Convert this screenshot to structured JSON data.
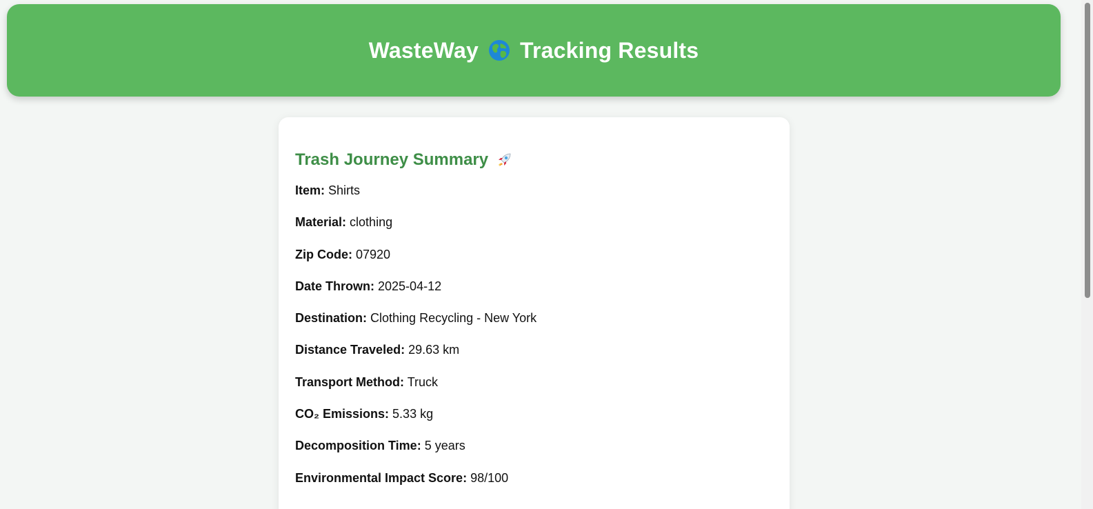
{
  "header": {
    "title_prefix": "WasteWay",
    "title_suffix": "Tracking Results",
    "icon": "globe-icon"
  },
  "summary": {
    "heading": "Trash Journey Summary",
    "heading_icon": "rocket-icon",
    "rows": [
      {
        "label": "Item:",
        "value": "Shirts"
      },
      {
        "label": "Material:",
        "value": "clothing"
      },
      {
        "label": "Zip Code:",
        "value": "07920"
      },
      {
        "label": "Date Thrown:",
        "value": "2025-04-12"
      },
      {
        "label": "Destination:",
        "value": "Clothing Recycling - New York"
      },
      {
        "label": "Distance Traveled:",
        "value": "29.63 km"
      },
      {
        "label": "Transport Method:",
        "value": "Truck"
      },
      {
        "label": "CO₂ Emissions:",
        "value": "5.33 kg"
      },
      {
        "label": "Decomposition Time:",
        "value": "5 years"
      },
      {
        "label": "Environmental Impact Score:",
        "value": "98/100"
      }
    ]
  },
  "colors": {
    "header_bg": "#5cb85f",
    "heading_green": "#3e8e47",
    "page_bg": "#f3f6f4"
  }
}
